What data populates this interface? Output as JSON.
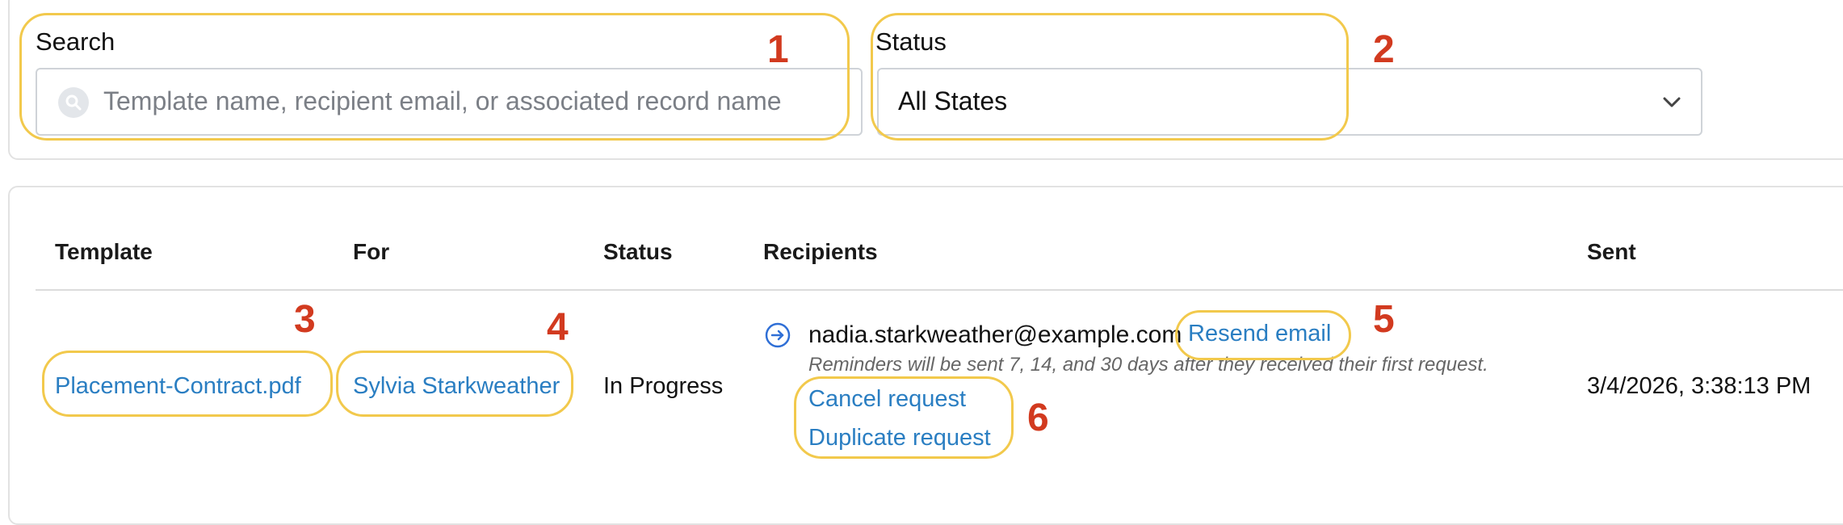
{
  "filters": {
    "search_label": "Search",
    "search_placeholder": "Template name, recipient email, or associated record name",
    "status_label": "Status",
    "status_value": "All States"
  },
  "table": {
    "headers": [
      "Template",
      "For",
      "Status",
      "Recipients",
      "Sent"
    ],
    "row": {
      "template": "Placement-Contract.pdf",
      "for": "Sylvia Starkweather",
      "status": "In Progress",
      "recipient_email": "nadia.starkweather@example.com",
      "resend_label": "Resend email",
      "reminder_text": "Reminders will be sent 7, 14, and 30 days after they received their first request.",
      "cancel_label": "Cancel request",
      "duplicate_label": "Duplicate request",
      "sent": "3/4/2026, 3:38:13 PM"
    }
  },
  "annotations": [
    "1",
    "2",
    "3",
    "4",
    "5",
    "6"
  ],
  "colors": {
    "link": "#2a7ec2",
    "highlight": "#f2c94c",
    "annotation": "#d23a1f"
  },
  "icons": {
    "search": "search-icon",
    "chevron": "chevron-down-icon",
    "recipient": "arrow-right-circle-icon"
  }
}
